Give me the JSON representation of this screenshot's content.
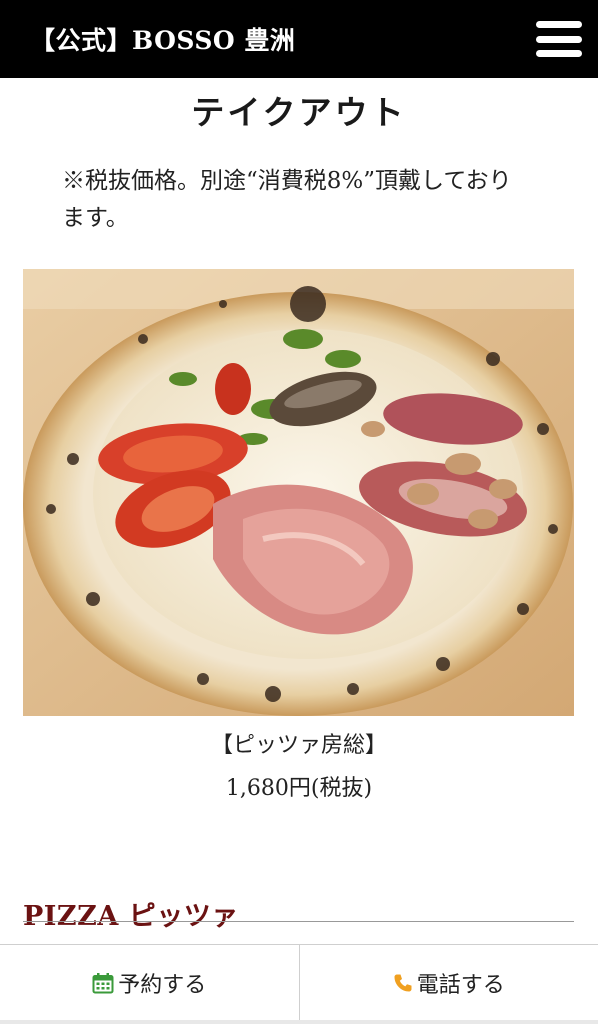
{
  "header": {
    "site_title": "【公式】BOSSO 豊洲",
    "menu_icon": "hamburger-menu-icon"
  },
  "main": {
    "title": "テイクアウト",
    "note": "※税抜価格。別途“消費税8%”頂戴しております。",
    "item": {
      "name": "【ピッツァ房総】",
      "price": "1,680円(税抜)"
    },
    "section_heading": "PIZZA ピッツァ"
  },
  "bottom_bar": {
    "reserve": {
      "label": "予約する",
      "icon": "calendar-icon",
      "icon_color": "#3a9a3a"
    },
    "call": {
      "label": "電話する",
      "icon": "phone-icon",
      "icon_color": "#f0a020"
    }
  },
  "colors": {
    "header_bg": "#000000",
    "section_heading": "#6b1212"
  }
}
